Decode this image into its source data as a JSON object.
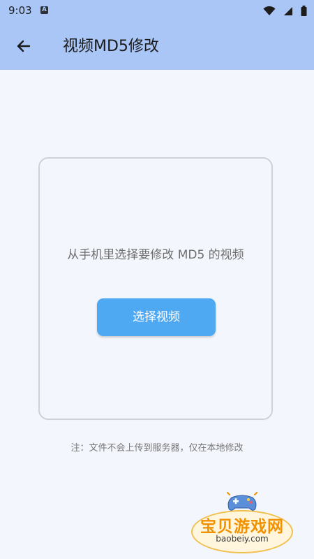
{
  "status_bar": {
    "time": "9:03",
    "notification_icon": "A",
    "icons": [
      "wifi-icon",
      "signal-icon",
      "battery-icon"
    ]
  },
  "app_bar": {
    "title": "视频MD5修改",
    "back_icon": "arrow-left-icon"
  },
  "card": {
    "prompt": "从手机里选择要修改 MD5 的视频",
    "button_label": "选择视频"
  },
  "note": "注：文件不会上传到服务器，仅在本地修改",
  "watermark": {
    "title": "宝贝游戏网",
    "url": "baobeiy.com"
  },
  "colors": {
    "header": "#a9c6f7",
    "background": "#f4f6fd",
    "button": "#4fa9f2",
    "card_border": "#cfd1d6",
    "watermark_orange": "#f29100"
  }
}
